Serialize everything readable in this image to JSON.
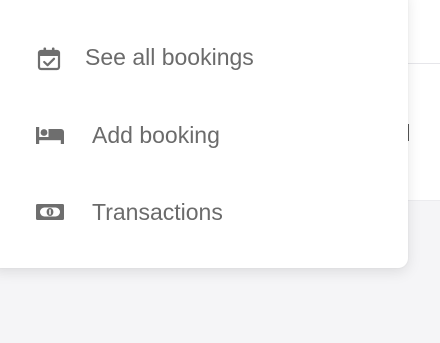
{
  "menu": {
    "items": [
      {
        "label": "See all bookings",
        "icon": "calendar-check-icon"
      },
      {
        "label": "Add booking",
        "icon": "bed-icon"
      },
      {
        "label": "Transactions",
        "icon": "money-bill-icon"
      }
    ]
  },
  "colors": {
    "text": "#6b6b6b",
    "icon": "#6e6e6e",
    "menu_bg": "#ffffff",
    "page_bg": "#f5f5f7"
  }
}
